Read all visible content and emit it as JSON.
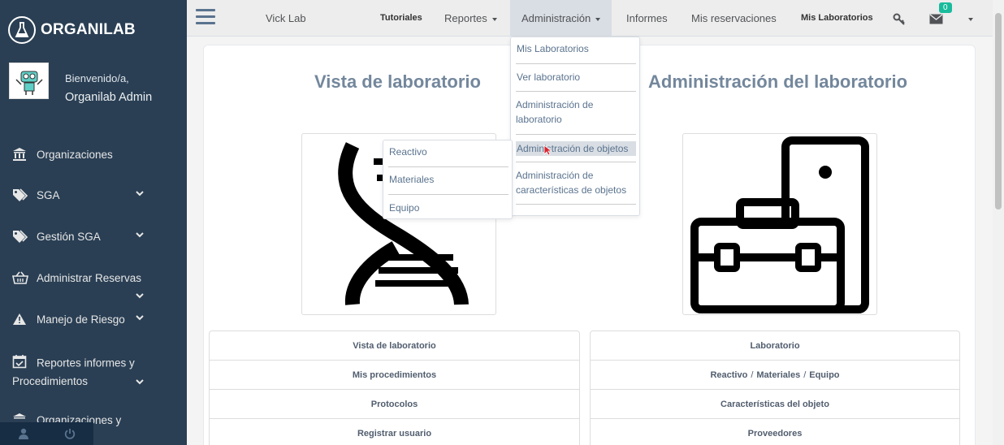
{
  "sidebar": {
    "brand": "ORGANILAB",
    "welcome": "Bienvenido/a,",
    "user": "Organilab Admin",
    "items": [
      {
        "label": "Organizaciones",
        "icon": "institution-icon"
      },
      {
        "label": "SGA",
        "icon": "tags-icon"
      },
      {
        "label": "Gestión SGA",
        "icon": "tags-icon"
      },
      {
        "label": "Administrar Reservas",
        "icon": "basket-icon"
      },
      {
        "label": "Manejo de Riesgo",
        "icon": "warning-icon"
      },
      {
        "label": "Reportes informes y Procedimientos",
        "icon": "calendar-check-icon"
      },
      {
        "label": "Organizaciones y",
        "icon": "institution-icon"
      }
    ]
  },
  "nav": {
    "lab": "Vick Lab",
    "tutorials": "Tutoriales",
    "reports": "Reportes",
    "admin": "Administración",
    "informs": "Informes",
    "reservations": "Mis reservaciones",
    "my_labs": "Mis Laboratorios",
    "mail_count": "0"
  },
  "admin_menu": [
    "Mis Laboratorios",
    "Ver laboratorio",
    "Administración de laboratorio",
    "Administración de objetos",
    "Administración de características de objetos"
  ],
  "objects_menu": [
    "Reactivo",
    "Materiales",
    "Equipo"
  ],
  "main": {
    "left_title": "Vista de laboratorio",
    "right_title": "Administración del laboratorio",
    "left_links": [
      "Vista de laboratorio",
      "Mis procedimientos",
      "Protocolos",
      "Registrar usuario"
    ],
    "right_links": {
      "laboratory": "Laboratorio",
      "reactive": "Reactivo",
      "materials": "Materiales",
      "equipment": "Equipo",
      "slash": "/",
      "characteristics": "Características del objeto",
      "providers": "Proveedores"
    }
  },
  "colors": {
    "sidebar": "#2a3f54",
    "accent": "#1abb9c",
    "heading": "#73879c"
  }
}
